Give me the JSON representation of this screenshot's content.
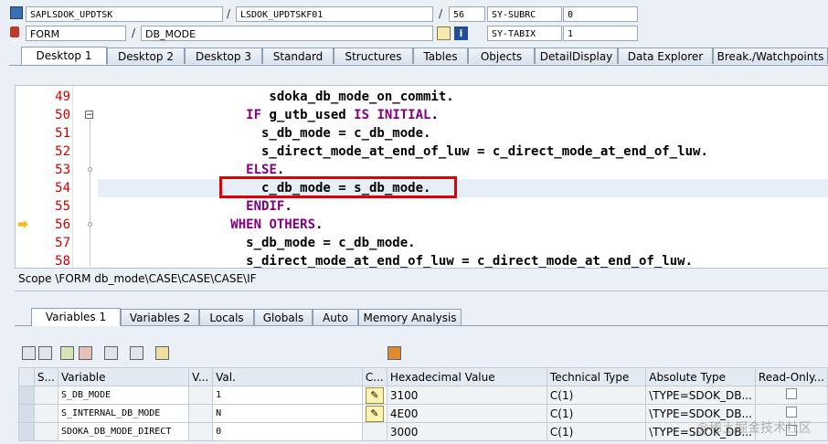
{
  "header": {
    "row1": {
      "program": "SAPLSDOK_UPDTSK",
      "include": "LSDOK_UPDTSKF01",
      "line": "56",
      "sysvar_name": "SY-SUBRC",
      "sysvar_value": "0"
    },
    "row2": {
      "event_type": "FORM",
      "event_name": "DB_MODE",
      "sysvar_name": "SY-TABIX",
      "sysvar_value": "1"
    }
  },
  "desktop_tabs": [
    "Desktop 1",
    "Desktop 2",
    "Desktop 3",
    "Standard",
    "Structures",
    "Tables",
    "Objects",
    "DetailDisplay",
    "Data Explorer",
    "Break./Watchpoints"
  ],
  "editor": {
    "lines": [
      {
        "num": "49",
        "code": "        sdoka_db_mode_on_commit."
      },
      {
        "num": "50",
        "code": "     IF g_utb_used IS INITIAL."
      },
      {
        "num": "51",
        "code": "       s_db_mode = c_db_mode."
      },
      {
        "num": "52",
        "code": "       s_direct_mode_at_end_of_luw = c_direct_mode_at_end_of_luw."
      },
      {
        "num": "53",
        "code": "     ELSE."
      },
      {
        "num": "54",
        "code": "       c_db_mode = s_db_mode."
      },
      {
        "num": "55",
        "code": "     ENDIF."
      },
      {
        "num": "56",
        "code": "   WHEN OTHERS."
      },
      {
        "num": "57",
        "code": "     s_db_mode = c_db_mode."
      },
      {
        "num": "58",
        "code": "     s_direct_mode_at_end_of_luw = c_direct_mode_at_end_of_luw."
      }
    ],
    "current_line": "56",
    "highlighted_line": "54"
  },
  "scope": "Scope \\FORM db_mode\\CASE\\CASE\\CASE\\IF",
  "variable_tabs": [
    "Variables 1",
    "Variables 2",
    "Locals",
    "Globals",
    "Auto",
    "Memory Analysis"
  ],
  "grid": {
    "headers": [
      "S...",
      "Variable",
      "V...",
      "Val.",
      "C...",
      "Hexadecimal Value",
      "Technical Type",
      "Absolute Type",
      "Read-Only..."
    ],
    "rows": [
      {
        "variable": "S_DB_MODE",
        "val": "1",
        "hex": "3100",
        "tech": "C(1)",
        "abs": "\\TYPE=SDOK_DB..."
      },
      {
        "variable": "S_INTERNAL_DB_MODE",
        "val": "N",
        "hex": "4E00",
        "tech": "C(1)",
        "abs": "\\TYPE=SDOK_DB..."
      },
      {
        "variable": "SDOKA_DB_MODE_DIRECT",
        "val": "0",
        "hex": "3000",
        "tech": "C(1)",
        "abs": "\\TYPE=SDOK_DB..."
      }
    ]
  },
  "watermark": "@稀土掘金技术社区"
}
